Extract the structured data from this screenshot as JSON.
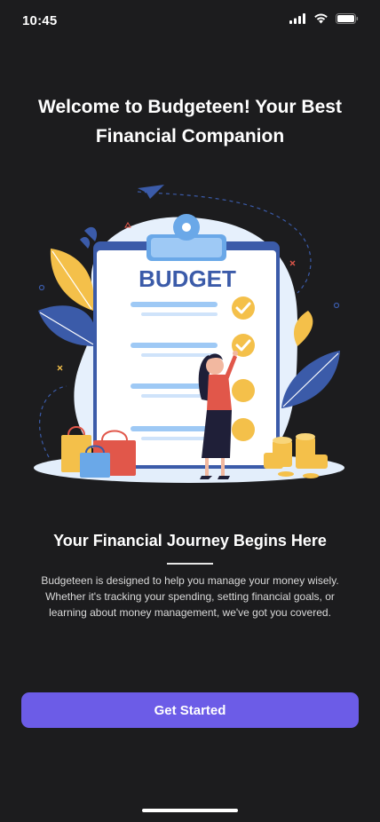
{
  "status_bar": {
    "time": "10:45",
    "icons": [
      "signal-icon",
      "wifi-icon",
      "battery-icon"
    ]
  },
  "welcome": {
    "title": "Welcome to Budgeteen! Your Best Financial Companion"
  },
  "illustration": {
    "clipboard_title": "BUDGET"
  },
  "intro": {
    "heading": "Your Financial Journey Begins Here",
    "body": "Budgeteen is designed to help you manage your money wisely. Whether it's tracking your spending, setting financial goals, or learning about money management, we've got you covered."
  },
  "cta": {
    "label": "Get Started"
  },
  "colors": {
    "background": "#1c1c1e",
    "accent": "#6c5ce7",
    "clipboard_blue": "#3b5ba9",
    "coin_yellow": "#f4c04a"
  }
}
